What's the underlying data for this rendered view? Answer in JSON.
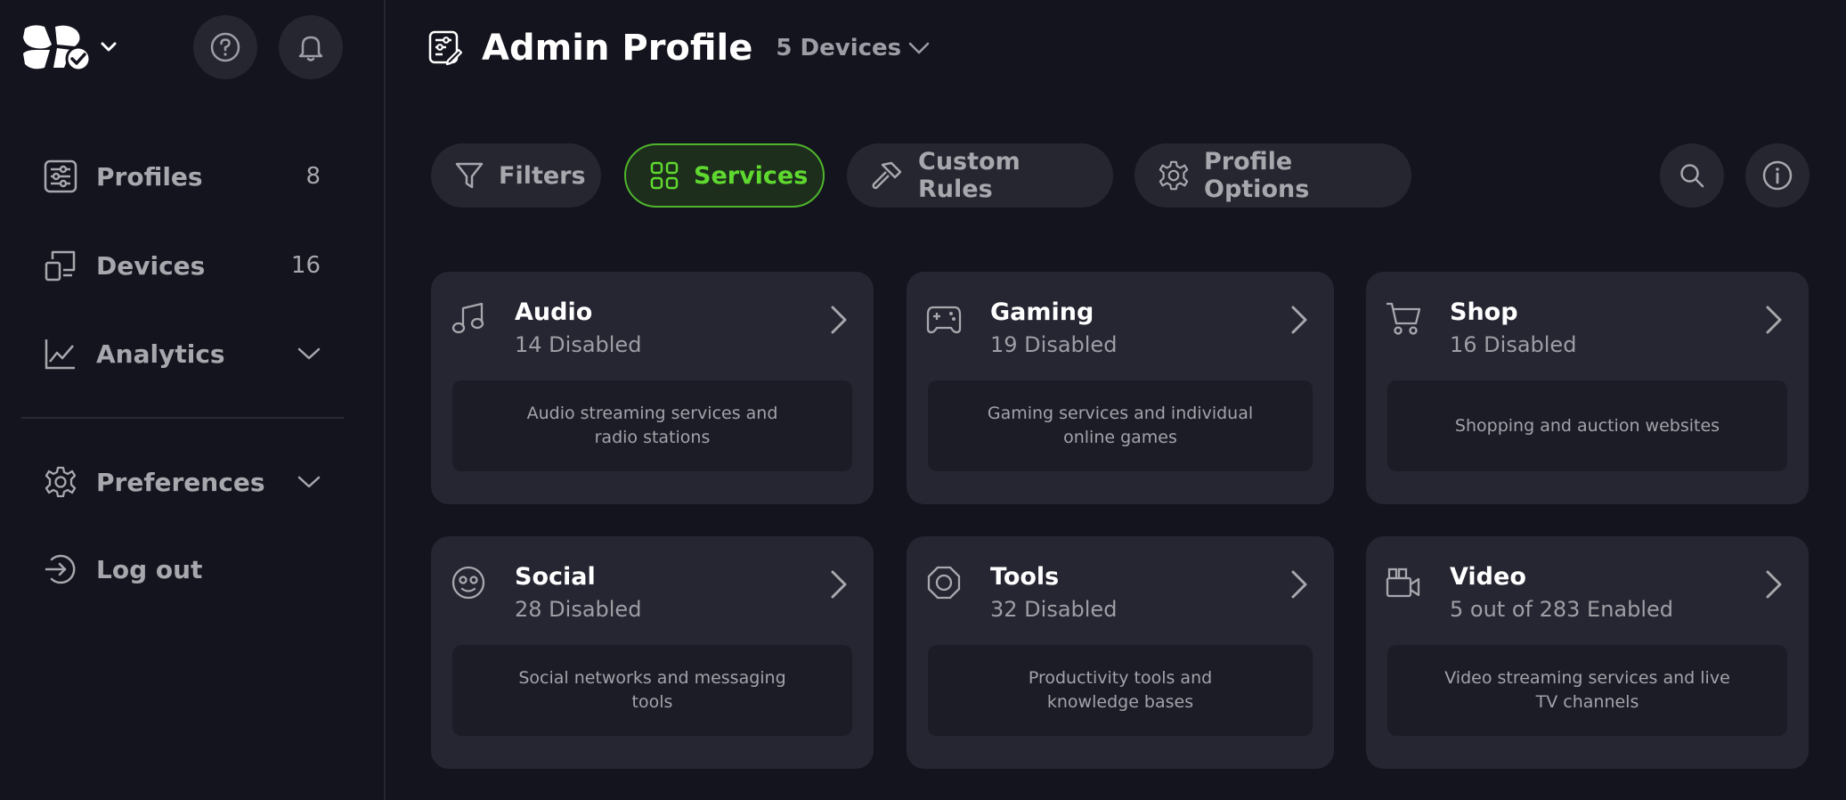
{
  "colors": {
    "background": "#14141e",
    "accent_green": "#5fd92f",
    "card_bg": "#262632",
    "muted_text": "#a7a7ae"
  },
  "sidebar": {
    "items": [
      {
        "label": "Profiles",
        "count": "8",
        "icon": "profiles-icon"
      },
      {
        "label": "Devices",
        "count": "16",
        "icon": "devices-icon"
      },
      {
        "label": "Analytics",
        "icon": "analytics-icon"
      },
      {
        "label": "Preferences",
        "icon": "gear-icon"
      },
      {
        "label": "Log out",
        "icon": "logout-icon"
      }
    ]
  },
  "header": {
    "title": "Admin Profile",
    "device_selector": "5 Devices"
  },
  "tabs": [
    {
      "label": "Filters",
      "icon": "filter-icon",
      "active": false
    },
    {
      "label": "Services",
      "icon": "grid-icon",
      "active": true
    },
    {
      "label": "Custom Rules",
      "icon": "hammer-icon",
      "active": false
    },
    {
      "label": "Profile Options",
      "icon": "gear-icon",
      "active": false
    }
  ],
  "cards": [
    {
      "title": "Audio",
      "status": "14 Disabled",
      "description": "Audio streaming services and radio stations",
      "icon": "music-note-icon"
    },
    {
      "title": "Gaming",
      "status": "19 Disabled",
      "description": "Gaming services and individual online games",
      "icon": "gamepad-icon"
    },
    {
      "title": "Shop",
      "status": "16 Disabled",
      "description": "Shopping and auction websites",
      "icon": "cart-icon"
    },
    {
      "title": "Social",
      "status": "28 Disabled",
      "description": "Social networks and messaging tools",
      "icon": "smiley-icon"
    },
    {
      "title": "Tools",
      "status": "32 Disabled",
      "description": "Productivity tools and knowledge bases",
      "icon": "tools-icon"
    },
    {
      "title": "Video",
      "status": "5 out of 283 Enabled",
      "description": "Video streaming services and live TV channels",
      "icon": "video-camera-icon"
    }
  ]
}
